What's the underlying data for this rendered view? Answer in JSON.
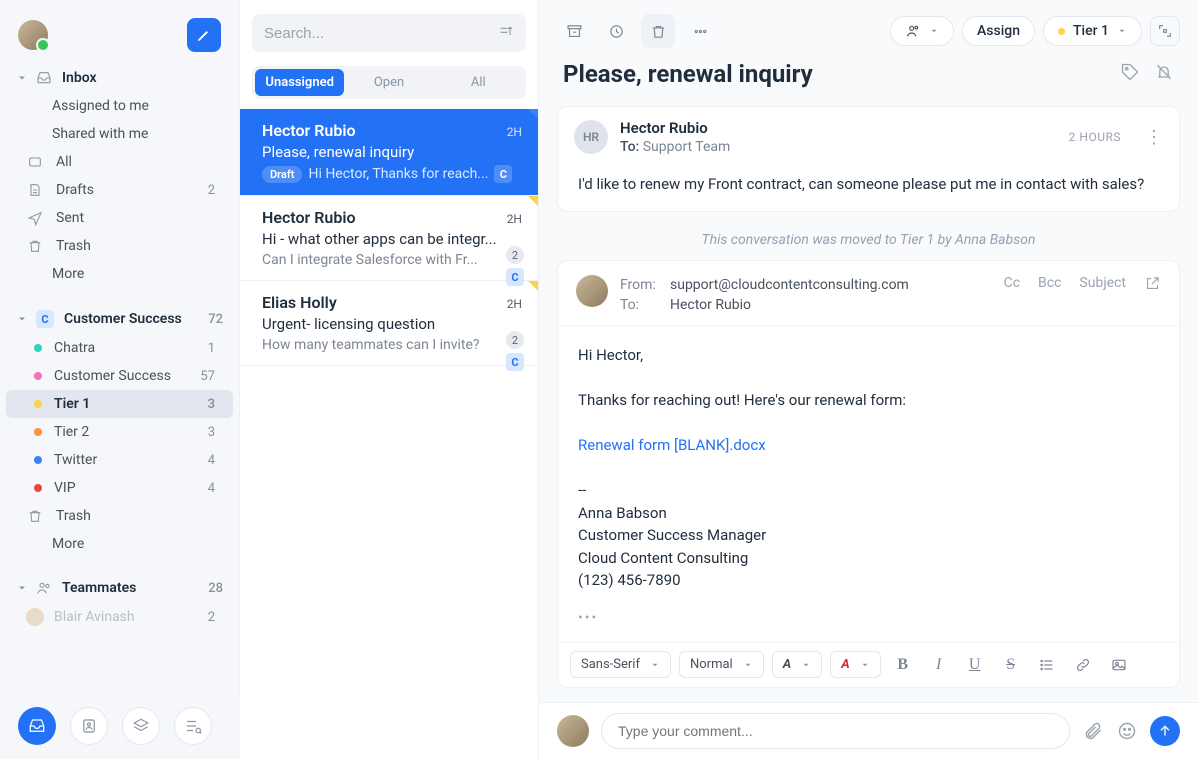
{
  "search": {
    "placeholder": "Search..."
  },
  "sidebar": {
    "inbox": {
      "label": "Inbox",
      "items": [
        {
          "label": "Assigned to me"
        },
        {
          "label": "Shared with me"
        },
        {
          "label": "All"
        },
        {
          "label": "Drafts",
          "count": "2"
        },
        {
          "label": "Sent"
        },
        {
          "label": "Trash"
        },
        {
          "label": "More"
        }
      ]
    },
    "customer_success": {
      "label": "Customer Success",
      "count": "72",
      "badge": "C",
      "items": [
        {
          "label": "Chatra",
          "count": "1",
          "dot": "#2dd4bf"
        },
        {
          "label": "Customer Success",
          "count": "57",
          "dot": "#f472b6"
        },
        {
          "label": "Tier 1",
          "count": "3",
          "dot": "#fcd34d"
        },
        {
          "label": "Tier 2",
          "count": "3",
          "dot": "#fb923c"
        },
        {
          "label": "Twitter",
          "count": "4",
          "dot": "#3b82f6"
        },
        {
          "label": "VIP",
          "count": "4",
          "dot": "#ef4444"
        },
        {
          "label": "Trash"
        },
        {
          "label": "More"
        }
      ]
    },
    "teammates": {
      "label": "Teammates",
      "count": "28",
      "items": [
        {
          "label": "Blair Avinash",
          "count": "2"
        }
      ]
    }
  },
  "convlist": {
    "tabs": [
      "Unassigned",
      "Open",
      "All"
    ],
    "items": [
      {
        "name": "Hector Rubio",
        "time": "2H",
        "subject": "Please, renewal inquiry",
        "draft": "Draft",
        "preview": "Hi Hector, Thanks for reach...",
        "badge": "C"
      },
      {
        "name": "Hector Rubio",
        "time": "2H",
        "subject": "Hi - what other apps can be integr...",
        "preview": "Can I integrate Salesforce with Fr...",
        "num": "2",
        "badge": "C"
      },
      {
        "name": "Elias Holly",
        "time": "2H",
        "subject": "Urgent- licensing question",
        "preview": "How many teammates can I invite?",
        "num": "2",
        "badge": "C"
      }
    ]
  },
  "detail": {
    "toolbar": {
      "assign_label": "Assign",
      "tier_label": "Tier 1"
    },
    "subject": "Please, renewal inquiry",
    "message": {
      "sender": "Hector Rubio",
      "initials": "HR",
      "to_label": "To:",
      "to": "Support Team",
      "when": "2 HOURS",
      "body": "I'd like to renew my Front contract, can someone please put me in contact with sales?"
    },
    "moved_note": "This conversation was moved to Tier 1 by Anna Babson",
    "compose": {
      "from_label": "From:",
      "from": "support@cloudcontentconsulting.com",
      "to_label": "To:",
      "to": "Hector Rubio",
      "cc": "Cc",
      "bcc": "Bcc",
      "subj": "Subject",
      "body_greeting": "Hi Hector,",
      "body_p1": "Thanks for reaching out! Here's our renewal form:",
      "body_link": "Renewal form [BLANK].docx",
      "sig_div": "--",
      "sig_name": "Anna Babson",
      "sig_title": "Customer Success Manager",
      "sig_company": "Cloud Content Consulting",
      "sig_phone": "(123) 456-7890",
      "font_family": "Sans-Serif",
      "font_size": "Normal"
    },
    "comment_placeholder": "Type your comment..."
  }
}
